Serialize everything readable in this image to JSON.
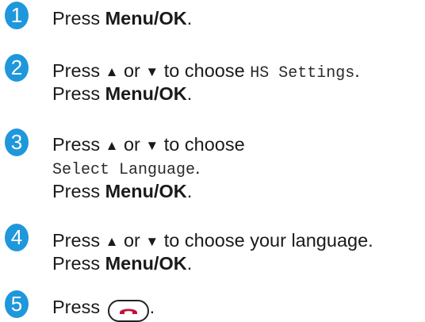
{
  "colors": {
    "badge": "#1f97dc",
    "end_key_icon": "#c0123c"
  },
  "icons": {
    "end_key": "phone-hangup-icon"
  },
  "steps": [
    {
      "number": "1",
      "lines": [
        {
          "press": "Press ",
          "key": "Menu/OK",
          "tail": "."
        }
      ]
    },
    {
      "number": "2",
      "lines": [
        {
          "press": "Press ",
          "up": "▲",
          "or": " or ",
          "down": "▼",
          "choose": " to choose ",
          "menu_item": "HS Settings",
          "tail": "."
        },
        {
          "press": "Press ",
          "key": "Menu/OK",
          "tail": "."
        }
      ]
    },
    {
      "number": "3",
      "lines": [
        {
          "press": "Press ",
          "up": "▲",
          "or": " or ",
          "down": "▼",
          "choose": " to choose"
        },
        {
          "menu_item": "Select Language",
          "tail": "."
        },
        {
          "press": "Press ",
          "key": "Menu/OK",
          "tail": "."
        }
      ]
    },
    {
      "number": "4",
      "lines": [
        {
          "press": "Press ",
          "up": "▲",
          "or": " or ",
          "down": "▼",
          "choose": " to choose your language."
        },
        {
          "press": "Press ",
          "key": "Menu/OK",
          "tail": "."
        }
      ]
    },
    {
      "number": "5",
      "lines": [
        {
          "press": "Press ",
          "tail": "."
        }
      ]
    }
  ]
}
